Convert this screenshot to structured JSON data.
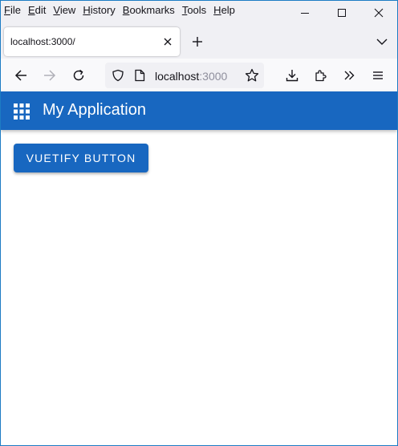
{
  "menubar": {
    "items": [
      {
        "label": "File",
        "accel": "F",
        "rest": "ile"
      },
      {
        "label": "Edit",
        "accel": "E",
        "rest": "dit"
      },
      {
        "label": "View",
        "accel": "V",
        "rest": "iew"
      },
      {
        "label": "History",
        "accel": "H",
        "rest": "istory"
      },
      {
        "label": "Bookmarks",
        "accel": "B",
        "rest": "ookmarks"
      },
      {
        "label": "Tools",
        "accel": "T",
        "rest": "ools"
      },
      {
        "label": "Help",
        "accel": "H",
        "rest": "elp"
      }
    ]
  },
  "tabs": [
    {
      "title": "localhost:3000/",
      "active": true
    }
  ],
  "urlbar": {
    "host": "localhost",
    "port": ":3000"
  },
  "app": {
    "title": "My Application",
    "button_label": "Vuetify Button",
    "primary_color": "#1867c0"
  }
}
